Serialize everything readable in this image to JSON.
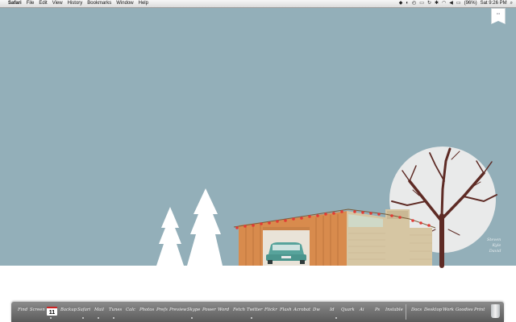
{
  "menubar": {
    "apple_glyph": "",
    "app_name": "Safari",
    "menus": [
      "File",
      "Edit",
      "View",
      "History",
      "Bookmarks",
      "Window",
      "Help"
    ],
    "battery": "(96%)",
    "clock": "Sat 9:26 PM"
  },
  "desktop": {
    "background_color": "#93afb9",
    "users": [
      "Steven",
      "Kyle",
      "David"
    ]
  },
  "dock": {
    "items": [
      "Find",
      "Screen",
      "11",
      "Backup",
      "Safari",
      "Mail",
      "Tunes",
      "Calc",
      "Photos",
      "Prefs",
      "Preview",
      "Skype",
      "Power",
      "Word",
      "Fetch",
      "Twitter",
      "Flickr",
      "Flash",
      "Acrobat",
      "Dw",
      "Id",
      "Quark",
      "Ai",
      "Ps",
      "Instable",
      "Docs",
      "Desktop",
      "Work",
      "Goodies",
      "Print"
    ]
  }
}
